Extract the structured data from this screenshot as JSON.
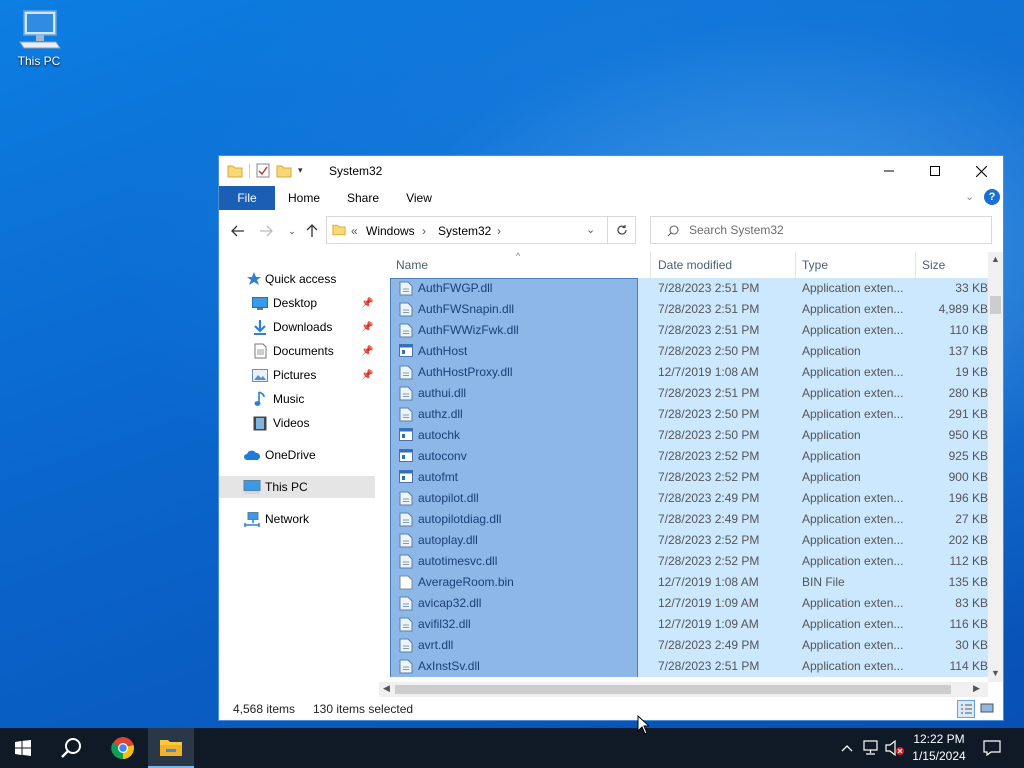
{
  "desktop": {
    "icon_label": "This PC"
  },
  "window": {
    "title": "System32"
  },
  "ribbon": {
    "tabs": [
      "File",
      "Home",
      "Share",
      "View"
    ]
  },
  "address": {
    "prefix": "«",
    "crumbs": [
      "Windows",
      "System32"
    ]
  },
  "search": {
    "placeholder": "Search System32"
  },
  "nav": {
    "quick_access": "Quick access",
    "items": [
      "Desktop",
      "Downloads",
      "Documents",
      "Pictures",
      "Music",
      "Videos"
    ],
    "onedrive": "OneDrive",
    "thispc": "This PC",
    "network": "Network"
  },
  "columns": {
    "name": "Name",
    "date": "Date modified",
    "type": "Type",
    "size": "Size"
  },
  "files": [
    {
      "name": "AuthFWGP.dll",
      "date": "7/28/2023 2:51 PM",
      "type": "Application exten...",
      "size": "33 KB",
      "kind": "dll"
    },
    {
      "name": "AuthFWSnapin.dll",
      "date": "7/28/2023 2:51 PM",
      "type": "Application exten...",
      "size": "4,989 KB",
      "kind": "dll"
    },
    {
      "name": "AuthFWWizFwk.dll",
      "date": "7/28/2023 2:51 PM",
      "type": "Application exten...",
      "size": "110 KB",
      "kind": "dll"
    },
    {
      "name": "AuthHost",
      "date": "7/28/2023 2:50 PM",
      "type": "Application",
      "size": "137 KB",
      "kind": "exe"
    },
    {
      "name": "AuthHostProxy.dll",
      "date": "12/7/2019 1:08 AM",
      "type": "Application exten...",
      "size": "19 KB",
      "kind": "dll"
    },
    {
      "name": "authui.dll",
      "date": "7/28/2023 2:51 PM",
      "type": "Application exten...",
      "size": "280 KB",
      "kind": "dll"
    },
    {
      "name": "authz.dll",
      "date": "7/28/2023 2:50 PM",
      "type": "Application exten...",
      "size": "291 KB",
      "kind": "dll"
    },
    {
      "name": "autochk",
      "date": "7/28/2023 2:50 PM",
      "type": "Application",
      "size": "950 KB",
      "kind": "exe"
    },
    {
      "name": "autoconv",
      "date": "7/28/2023 2:52 PM",
      "type": "Application",
      "size": "925 KB",
      "kind": "exe"
    },
    {
      "name": "autofmt",
      "date": "7/28/2023 2:52 PM",
      "type": "Application",
      "size": "900 KB",
      "kind": "exe"
    },
    {
      "name": "autopilot.dll",
      "date": "7/28/2023 2:49 PM",
      "type": "Application exten...",
      "size": "196 KB",
      "kind": "dll"
    },
    {
      "name": "autopilotdiag.dll",
      "date": "7/28/2023 2:49 PM",
      "type": "Application exten...",
      "size": "27 KB",
      "kind": "dll"
    },
    {
      "name": "autoplay.dll",
      "date": "7/28/2023 2:52 PM",
      "type": "Application exten...",
      "size": "202 KB",
      "kind": "dll"
    },
    {
      "name": "autotimesvc.dll",
      "date": "7/28/2023 2:52 PM",
      "type": "Application exten...",
      "size": "112 KB",
      "kind": "dll"
    },
    {
      "name": "AverageRoom.bin",
      "date": "12/7/2019 1:08 AM",
      "type": "BIN File",
      "size": "135 KB",
      "kind": "bin"
    },
    {
      "name": "avicap32.dll",
      "date": "12/7/2019 1:09 AM",
      "type": "Application exten...",
      "size": "83 KB",
      "kind": "dll"
    },
    {
      "name": "avifil32.dll",
      "date": "12/7/2019 1:09 AM",
      "type": "Application exten...",
      "size": "116 KB",
      "kind": "dll"
    },
    {
      "name": "avrt.dll",
      "date": "7/28/2023 2:49 PM",
      "type": "Application exten...",
      "size": "30 KB",
      "kind": "dll"
    },
    {
      "name": "AxInstSv.dll",
      "date": "7/28/2023 2:51 PM",
      "type": "Application exten...",
      "size": "114 KB",
      "kind": "dll"
    }
  ],
  "status": {
    "items": "4,568 items",
    "selected": "130 items selected"
  },
  "clock": {
    "time": "12:22 PM",
    "date": "1/15/2024"
  },
  "colors": {
    "accent": "#1a5fb4",
    "selection": "#cce8ff",
    "selection_name": "#8cb7e6",
    "taskbar": "#101a26"
  }
}
